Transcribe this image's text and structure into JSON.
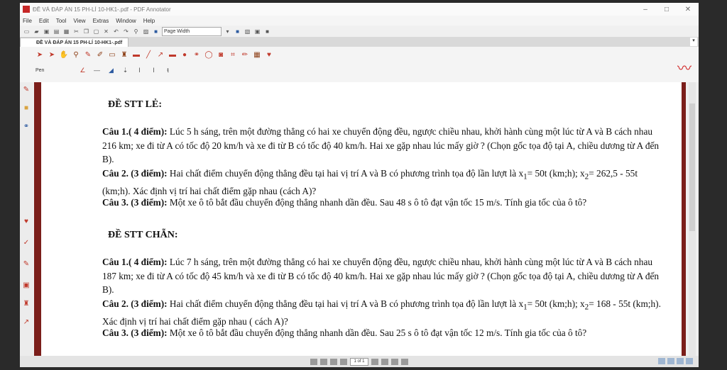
{
  "window": {
    "title": "ĐỀ VÀ ĐÁP ÁN 15 PH-LÍ 10-HK1-.pdf - PDF Annotator",
    "minimize_icon": "–",
    "maximize_icon": "□",
    "close_icon": "✕"
  },
  "menu": [
    "File",
    "Edit",
    "Tool",
    "View",
    "Extras",
    "Window",
    "Help"
  ],
  "toolbar": {
    "zoom_value": "Page Width"
  },
  "tab": {
    "label": "ĐỀ VÀ ĐÁP ÁN 15 PH-LÍ 10-HK1-.pdf"
  },
  "annotation_bar": {
    "pen_label": "Pen"
  },
  "document": {
    "section_odd": {
      "heading": "ĐỀ STT LẺ:",
      "q1_label": "Câu 1.( 4 điểm):",
      "q1_text": "Lúc 5 h sáng, trên một đường thẳng có hai xe chuyển động đều, ngược chiều nhau, khởi hành cùng một lúc từ A và B cách nhau 216 km; xe đi từ A có tốc độ 20 km/h và xe đi từ B có tốc độ 40 km/h. Hai xe gặp nhau lúc mấy giờ ? (Chọn gốc tọa độ tại A, chiều dương từ A đến B).",
      "q2_label": "Câu 2. (3 điểm):",
      "q2_text_a": "Hai chất điểm chuyển động thẳng đều tại hai vị trí A và B có phương trình tọa độ lần lượt là x",
      "q2_sub1": "1",
      "q2_text_b": "= 50t (km;h); x",
      "q2_sub2": "2",
      "q2_text_c": "= 262,5 - 55t (km;h). Xác định vị trí hai chất điểm gặp nhau (cách A)?",
      "q3_label": "Câu 3. (3 điểm):",
      "q3_text": "Một xe ô tô bắt đầu chuyển động thẳng nhanh dần đều. Sau 48 s ô tô đạt vận tốc 15 m/s. Tính gia tốc của ô tô?"
    },
    "section_even": {
      "heading": "ĐỀ STT CHẴN:",
      "q1_label": "Câu 1.( 4 điểm):",
      "q1_text": "Lúc 7 h sáng, trên một đường thẳng có hai xe chuyển động đều, ngược chiều nhau, khởi hành cùng một lúc từ A và B cách nhau 187 km; xe đi từ A có tốc độ 45 km/h và xe đi từ B có tốc độ 40 km/h. Hai xe gặp nhau lúc mấy giờ ? (Chọn gốc tọa độ tại A, chiều dương từ A đến B).",
      "q2_label": "Câu 2. (3 điểm):",
      "q2_text_a": "Hai chất điểm chuyển động thẳng đều tại hai vị trí A và B có phương trình tọa độ lần lượt là x",
      "q2_sub1": "1",
      "q2_text_b": "= 50t (km;h); x",
      "q2_sub2": "2",
      "q2_text_c": "= 168 - 55t (km;h). Xác định vị trí hai chất điểm gặp nhau ( cách A)?",
      "q3_label": "Câu 3. (3 điểm):",
      "q3_text": "Một xe ô tô bắt đầu chuyển động thẳng nhanh dần đều. Sau 25 s ô tô đạt vận tốc 12 m/s. Tính gia tốc của ô tô?"
    }
  },
  "statusbar": {
    "page_indicator": "1 of 1"
  }
}
